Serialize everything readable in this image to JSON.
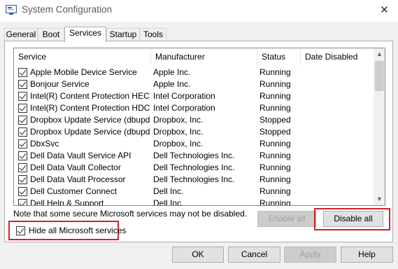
{
  "window": {
    "title": "System Configuration",
    "close_glyph": "✕",
    "icon": "msconfig-icon"
  },
  "tabs": [
    {
      "label": "General",
      "active": false
    },
    {
      "label": "Boot",
      "active": false
    },
    {
      "label": "Services",
      "active": true
    },
    {
      "label": "Startup",
      "active": false
    },
    {
      "label": "Tools",
      "active": false
    }
  ],
  "services_table": {
    "columns": [
      "Service",
      "Manufacturer",
      "Status",
      "Date Disabled"
    ],
    "rows": [
      {
        "checked": true,
        "service": "Apple Mobile Device Service",
        "manufacturer": "Apple Inc.",
        "status": "Running",
        "date_disabled": ""
      },
      {
        "checked": true,
        "service": "Bonjour Service",
        "manufacturer": "Apple Inc.",
        "status": "Running",
        "date_disabled": ""
      },
      {
        "checked": true,
        "service": "Intel(R) Content Protection HEC...",
        "manufacturer": "Intel Corporation",
        "status": "Running",
        "date_disabled": ""
      },
      {
        "checked": true,
        "service": "Intel(R) Content Protection HDC...",
        "manufacturer": "Intel Corporation",
        "status": "Running",
        "date_disabled": ""
      },
      {
        "checked": true,
        "service": "Dropbox Update Service (dbupd...",
        "manufacturer": "Dropbox, Inc.",
        "status": "Stopped",
        "date_disabled": ""
      },
      {
        "checked": true,
        "service": "Dropbox Update Service (dbupd...",
        "manufacturer": "Dropbox, Inc.",
        "status": "Stopped",
        "date_disabled": ""
      },
      {
        "checked": true,
        "service": "DbxSvc",
        "manufacturer": "Dropbox, Inc.",
        "status": "Running",
        "date_disabled": ""
      },
      {
        "checked": true,
        "service": "Dell Data Vault Service API",
        "manufacturer": "Dell Technologies Inc.",
        "status": "Running",
        "date_disabled": ""
      },
      {
        "checked": true,
        "service": "Dell Data Vault Collector",
        "manufacturer": "Dell Technologies Inc.",
        "status": "Running",
        "date_disabled": ""
      },
      {
        "checked": true,
        "service": "Dell Data Vault Processor",
        "manufacturer": "Dell Technologies Inc.",
        "status": "Running",
        "date_disabled": ""
      },
      {
        "checked": true,
        "service": "Dell Customer Connect",
        "manufacturer": "Dell Inc.",
        "status": "Running",
        "date_disabled": ""
      },
      {
        "checked": true,
        "service": "Dell Help & Support",
        "manufacturer": "Dell Inc.",
        "status": "Running",
        "date_disabled": ""
      }
    ]
  },
  "scrollbar": {
    "up_glyph": "▲",
    "down_glyph": "▼"
  },
  "note": "Note that some secure Microsoft services may not be disabled.",
  "buttons": {
    "enable_all": {
      "label": "Enable all",
      "enabled": false
    },
    "disable_all": {
      "label": "Disable all",
      "enabled": true
    },
    "ok": "OK",
    "cancel": "Cancel",
    "apply": {
      "label": "Apply",
      "enabled": false
    },
    "help": "Help"
  },
  "hide_ms": {
    "label": "Hide all Microsoft services",
    "checked": true
  },
  "highlight_color": "#d4202a"
}
